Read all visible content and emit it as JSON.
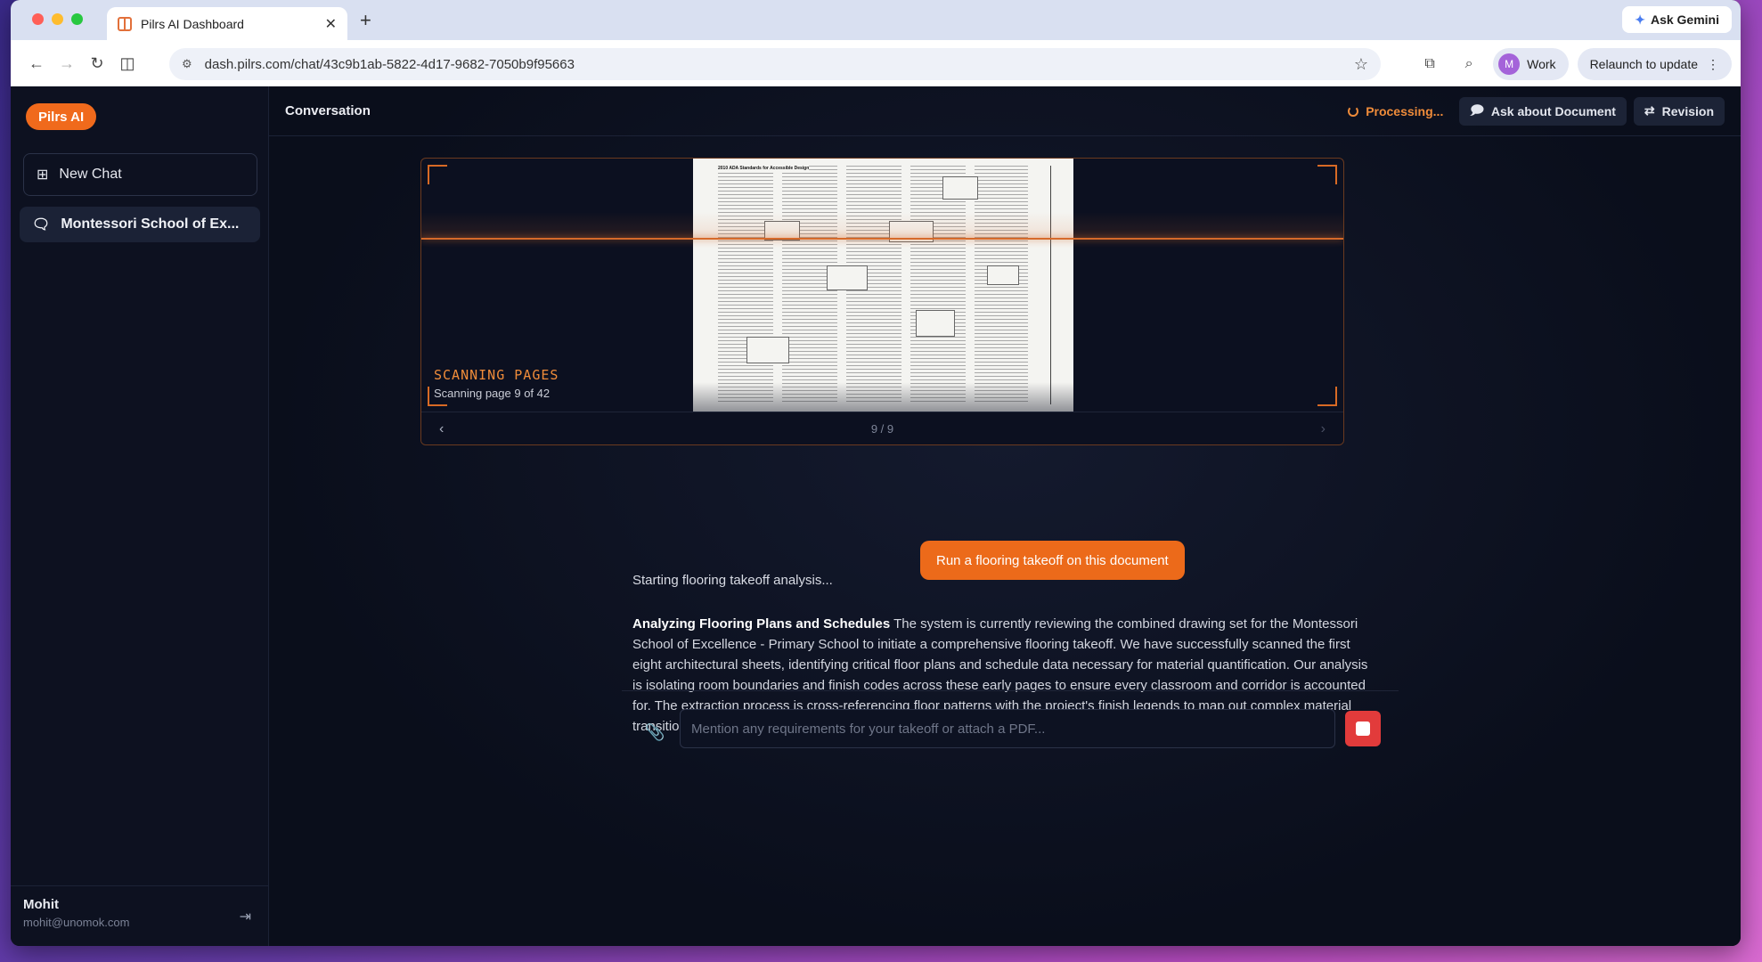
{
  "browser": {
    "tab_title": "Pilrs AI Dashboard",
    "url": "dash.pilrs.com/chat/43c9b1ab-5822-4d17-9682-7050b9f95663",
    "gemini_label": "Ask Gemini",
    "profile_initial": "M",
    "profile_label": "Work",
    "relaunch_label": "Relaunch to update"
  },
  "sidebar": {
    "brand": "Pilrs AI",
    "new_chat_label": "New Chat",
    "chats": [
      {
        "label": "Montessori School of Ex..."
      }
    ],
    "user": {
      "name": "Mohit",
      "email": "mohit@unomok.com"
    }
  },
  "header": {
    "title": "Conversation",
    "status": "Processing...",
    "ask_doc_label": "Ask about Document",
    "revision_label": "Revision"
  },
  "scanner": {
    "title": "SCANNING PAGES",
    "subtitle": "Scanning page 9 of 42",
    "page_indicator": "9 / 9",
    "doc_heading": "2010 ADA Standards for Accessible Design"
  },
  "messages": {
    "user": "Run a flooring takeoff on this document",
    "ai_start": "Starting flooring takeoff analysis...",
    "ai_heading": "Analyzing Flooring Plans and Schedules",
    "ai_body": "The system is currently reviewing the combined drawing set for the Montessori School of Excellence - Primary School to initiate a comprehensive flooring takeoff. We have successfully scanned the first eight architectural sheets, identifying critical floor plans and schedule data necessary for material quantification. Our analysis is isolating room boundaries and finish codes across these early pages to ensure every classroom and corridor is accounted for. The extraction process is cross-referencing floor patterns with the project's finish legends to map out complex material transitions. This initial pass ensures all specified flooring types, from res"
  },
  "composer": {
    "placeholder": "Mention any requirements for your takeoff or attach a PDF..."
  },
  "colors": {
    "accent": "#ec6a1a",
    "stop": "#e23b3b",
    "background": "#0b0f1e"
  }
}
